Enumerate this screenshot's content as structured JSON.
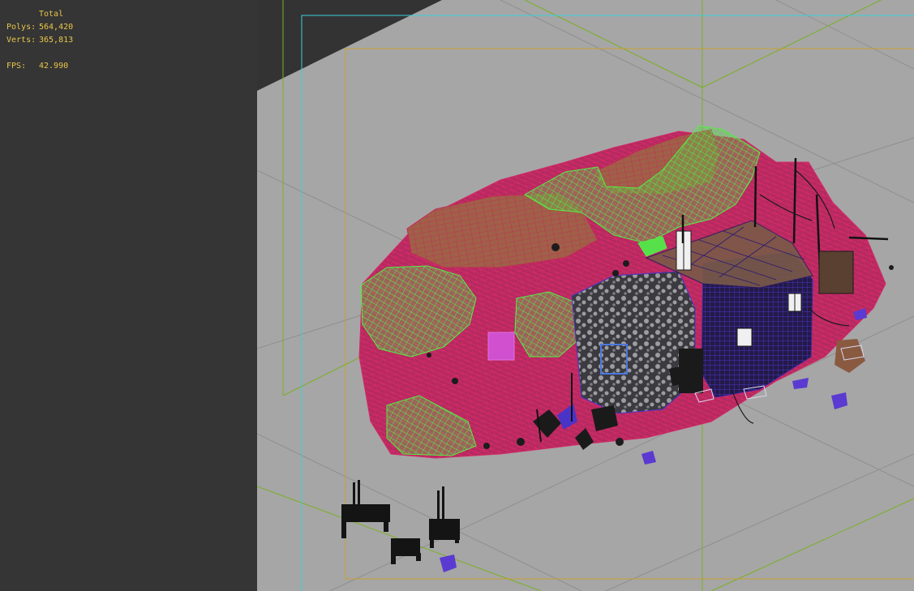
{
  "stats": {
    "title": "Total",
    "polys_label": "Polys:",
    "polys_value": "564,420",
    "verts_label": "Verts:",
    "verts_value": "365,813",
    "fps_label": "FPS:",
    "fps_value": "42.990"
  },
  "colors": {
    "panel_bg": "#353535",
    "viewport_bg": "#a6a6a6",
    "stats_text": "#e8c64a",
    "wire_green": "#4fe04a",
    "wire_pink": "#c8245e",
    "wire_brown": "#9a5a3c",
    "wire_purple": "#3a25a0",
    "safe_frame_cyan": "#3ad0d8",
    "safe_frame_orange": "#c8a030",
    "grid_green": "#7ab024"
  }
}
